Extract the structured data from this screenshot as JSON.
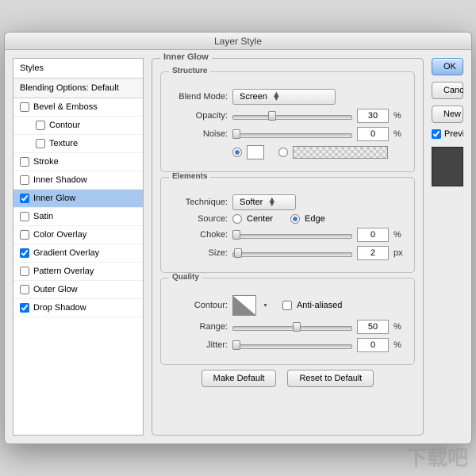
{
  "window": {
    "title": "Layer Style"
  },
  "sidebar": {
    "header": "Styles",
    "subheader": "Blending Options: Default",
    "items": [
      {
        "label": "Bevel & Emboss",
        "checked": false,
        "indent": false
      },
      {
        "label": "Contour",
        "checked": false,
        "indent": true
      },
      {
        "label": "Texture",
        "checked": false,
        "indent": true
      },
      {
        "label": "Stroke",
        "checked": false,
        "indent": false
      },
      {
        "label": "Inner Shadow",
        "checked": false,
        "indent": false
      },
      {
        "label": "Inner Glow",
        "checked": true,
        "indent": false,
        "selected": true
      },
      {
        "label": "Satin",
        "checked": false,
        "indent": false
      },
      {
        "label": "Color Overlay",
        "checked": false,
        "indent": false
      },
      {
        "label": "Gradient Overlay",
        "checked": true,
        "indent": false
      },
      {
        "label": "Pattern Overlay",
        "checked": false,
        "indent": false
      },
      {
        "label": "Outer Glow",
        "checked": false,
        "indent": false
      },
      {
        "label": "Drop Shadow",
        "checked": true,
        "indent": false
      }
    ]
  },
  "panel": {
    "title": "Inner Glow",
    "structure": {
      "legend": "Structure",
      "blend_mode_label": "Blend Mode:",
      "blend_mode_value": "Screen",
      "opacity_label": "Opacity:",
      "opacity_value": "30",
      "opacity_unit": "%",
      "noise_label": "Noise:",
      "noise_value": "0",
      "noise_unit": "%"
    },
    "elements": {
      "legend": "Elements",
      "technique_label": "Technique:",
      "technique_value": "Softer",
      "source_label": "Source:",
      "source_center": "Center",
      "source_edge": "Edge",
      "source_selected": "edge",
      "choke_label": "Choke:",
      "choke_value": "0",
      "choke_unit": "%",
      "size_label": "Size:",
      "size_value": "2",
      "size_unit": "px"
    },
    "quality": {
      "legend": "Quality",
      "contour_label": "Contour:",
      "anti_aliased_label": "Anti-aliased",
      "anti_aliased_checked": false,
      "range_label": "Range:",
      "range_value": "50",
      "range_unit": "%",
      "jitter_label": "Jitter:",
      "jitter_value": "0",
      "jitter_unit": "%"
    },
    "make_default": "Make Default",
    "reset_default": "Reset to Default"
  },
  "right": {
    "ok": "OK",
    "cancel": "Cancel",
    "new_style": "New Style...",
    "preview_label": "Preview",
    "preview_checked": true
  },
  "watermark": "下载吧"
}
